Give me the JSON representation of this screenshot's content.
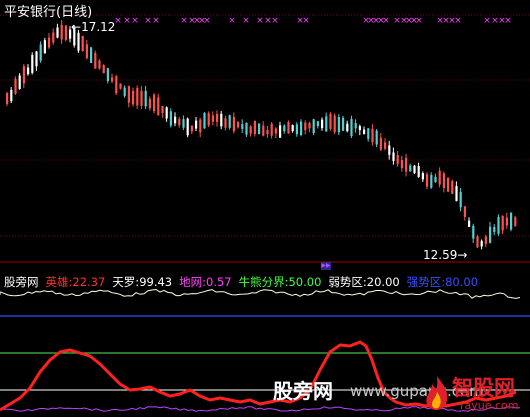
{
  "title": "平安银行(日线)",
  "high_label": "17.12",
  "low_label": "12.59",
  "indicator": {
    "name": "股旁网",
    "items": [
      {
        "label": "英雄: ",
        "value": "22.37",
        "color": "#ff3030"
      },
      {
        "label": "天罗: ",
        "value": "99.43",
        "color": "#ffffff"
      },
      {
        "label": "地网: ",
        "value": "0.57",
        "color": "#ff40ff"
      },
      {
        "label": "牛熊分界: ",
        "value": "50.00",
        "color": "#40ff40"
      },
      {
        "label": "弱势区: ",
        "value": "20.00",
        "color": "#ffffff"
      },
      {
        "label": "强势区: ",
        "value": "80.00",
        "color": "#3050ff"
      }
    ]
  },
  "watermark": {
    "text1": "股旁网",
    "text2": "www.gupang.com",
    "logo": "智股网",
    "logo_sub": "rayue.com"
  },
  "colors": {
    "up_candle": "#ff5050",
    "down_candle": "#50d0d0",
    "neutral_candle": "#ffffff",
    "marker": "#ff40ff",
    "hero_line": "#ff2020",
    "sky_line": "#ffffe0",
    "earth_line": "#c040ff",
    "bull_bear": "#40c040",
    "strong": "#3050ff",
    "weak": "#ffffff"
  },
  "chart_data": {
    "type": "line",
    "title": "平安银行(日线)",
    "price_high": 17.12,
    "price_low": 12.59,
    "series": [
      {
        "name": "英雄",
        "last": 22.37
      },
      {
        "name": "天罗",
        "last": 99.43
      },
      {
        "name": "地网",
        "last": 0.57
      },
      {
        "name": "牛熊分界",
        "value": 50.0
      },
      {
        "name": "弱势区",
        "value": 20.0
      },
      {
        "name": "强势区",
        "value": 80.0
      }
    ]
  }
}
